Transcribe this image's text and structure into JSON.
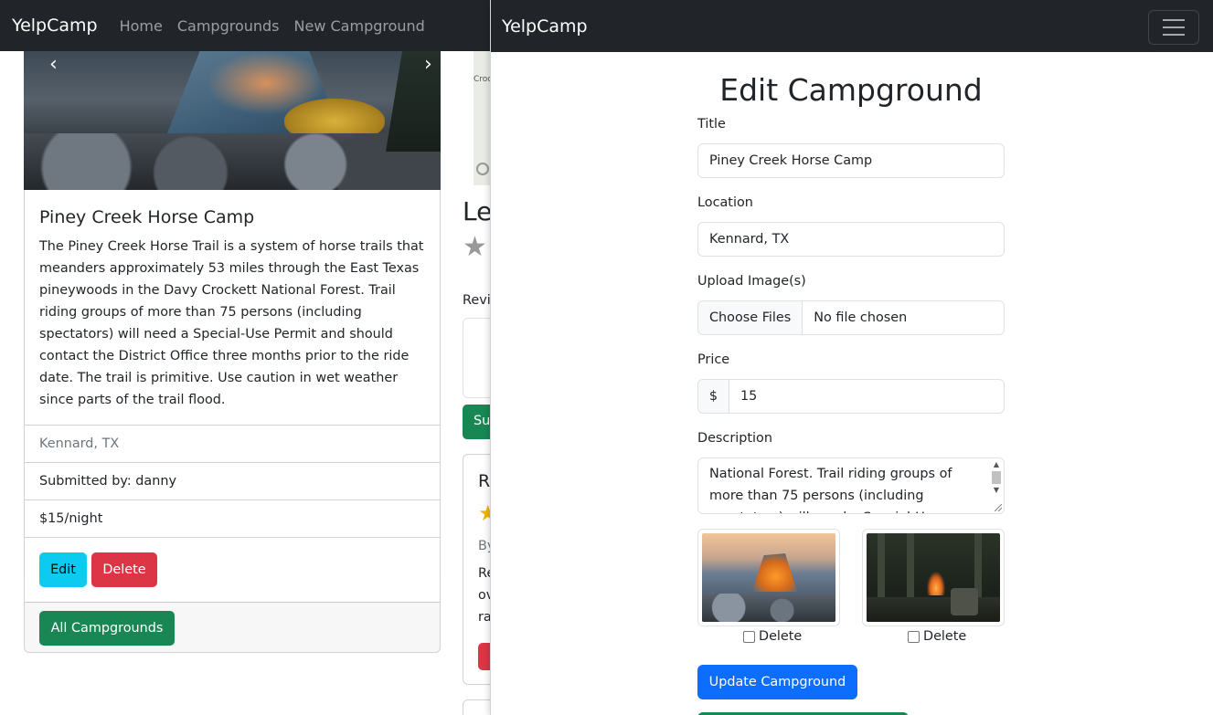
{
  "back": {
    "nav": {
      "brand": "YelpCamp",
      "links": [
        "Home",
        "Campgrounds",
        "New Campground"
      ]
    },
    "carousel": {
      "prev_icon": "‹",
      "next_icon": "›"
    },
    "campground": {
      "title": "Piney Creek Horse Camp",
      "description": "The Piney Creek Horse Trail is a system of horse trails that meanders approximately 53 miles through the East Texas pineywoods in the Davy Crockett National Forest. Trail riding groups of more than 75 persons (including spectators) will need a Special-Use Permit and should contact the District Office three months prior to the ride date. The trail is primitive. Use caution in wet weather since parts of the trail flood.",
      "location": "Kennard, TX",
      "submitted_by": "Submitted by: danny",
      "price": "$15/night",
      "edit_label": "Edit",
      "delete_label": "Delete",
      "all_label": "All Campgrounds"
    },
    "map_fragment": "Croc",
    "review_section": {
      "heading_fragment": "Le",
      "label_fragment": "Revi",
      "submit_fragment": "Su",
      "card_title_fragment": "R",
      "by_fragment": "By",
      "line_fragments": [
        "Re",
        "ov",
        "ra"
      ],
      "delete_fragment": "D"
    },
    "colors": {
      "navbar": "#212529",
      "info": "#0dcaf0",
      "danger": "#dc3545",
      "success": "#198754"
    }
  },
  "front": {
    "nav": {
      "brand": "YelpCamp",
      "toggler_icon": "hamburger-icon"
    },
    "form": {
      "heading": "Edit Campground",
      "title_label": "Title",
      "title_value": "Piney Creek Horse Camp",
      "location_label": "Location",
      "location_value": "Kennard, TX",
      "upload_label": "Upload Image(s)",
      "choose_files": "Choose Files",
      "no_file": "No file chosen",
      "price_label": "Price",
      "currency": "$",
      "price_value": "15",
      "description_label": "Description",
      "description_visible": "National Forest. Trail riding groups of more than 75 persons (including spectators) will need a Special-Use",
      "images": [
        {
          "delete_label": "Delete",
          "checked": false
        },
        {
          "delete_label": "Delete",
          "checked": false
        }
      ],
      "submit_label": "Update Campground"
    },
    "colors": {
      "primary": "#0d6efd",
      "success": "#198754"
    }
  }
}
